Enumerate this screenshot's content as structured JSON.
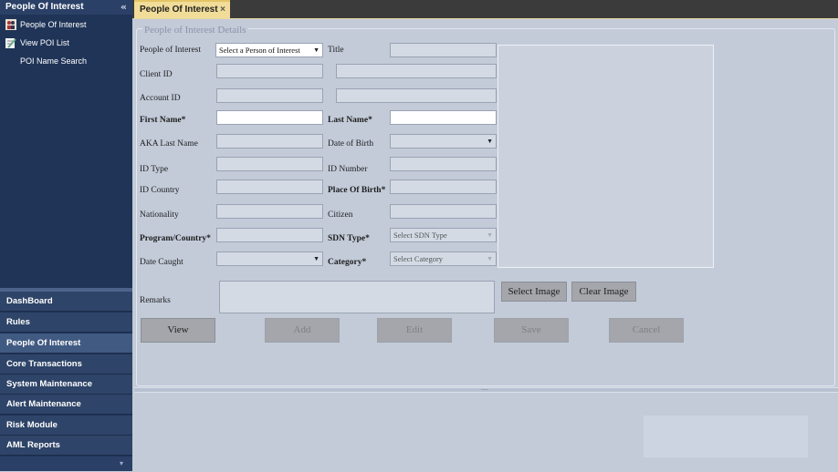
{
  "sidebar": {
    "header": "People Of Interest",
    "collapse_icon": "«",
    "items": [
      {
        "label": "People Of Interest",
        "icon": "people-icon"
      },
      {
        "label": "View POI List",
        "icon": "pencil-list-icon"
      },
      {
        "label": "POI Name Search",
        "icon": ""
      }
    ],
    "nav": [
      {
        "label": "DashBoard",
        "active": false
      },
      {
        "label": "Rules",
        "active": false
      },
      {
        "label": "People Of Interest",
        "active": true
      },
      {
        "label": "Core Transactions",
        "active": false
      },
      {
        "label": "System Maintenance",
        "active": false
      },
      {
        "label": "Alert Maintenance",
        "active": false
      },
      {
        "label": "Risk Module",
        "active": false
      },
      {
        "label": "AML Reports",
        "active": false
      }
    ],
    "more_icon": "▾"
  },
  "tab": {
    "label": "People Of Interest",
    "close": "×"
  },
  "form": {
    "group_title": "People of Interest Details",
    "person_label": "People of Interest",
    "person_select": "Select a Person of Interest",
    "title_label": "Title",
    "client_id_label": "Client ID",
    "account_id_label": "Account ID",
    "first_name_label": "First Name*",
    "last_name_label": "Last Name*",
    "aka_label": "AKA Last Name",
    "dob_label": "Date of Birth",
    "id_type_label": "ID Type",
    "id_number_label": "ID Number",
    "id_country_label": "ID Country",
    "place_of_birth_label": "Place Of Birth*",
    "nationality_label": "Nationality",
    "citizen_label": "Citizen",
    "program_label": "Program/Country*",
    "sdn_type_label": "SDN Type*",
    "sdn_type_select": "Select SDN Type",
    "date_caught_label": "Date Caught",
    "category_label": "Category*",
    "category_select": "Select Category",
    "remarks_label": "Remarks",
    "select_image": "Select Image",
    "clear_image": "Clear Image"
  },
  "buttons": {
    "view": "View",
    "add": "Add",
    "edit": "Edit",
    "save": "Save",
    "cancel": "Cancel"
  },
  "splitter_grip": "....",
  "colors": {
    "sidebar": "#1f3457",
    "tab_active": "#f1dd99",
    "content": "#c3cbd9"
  }
}
